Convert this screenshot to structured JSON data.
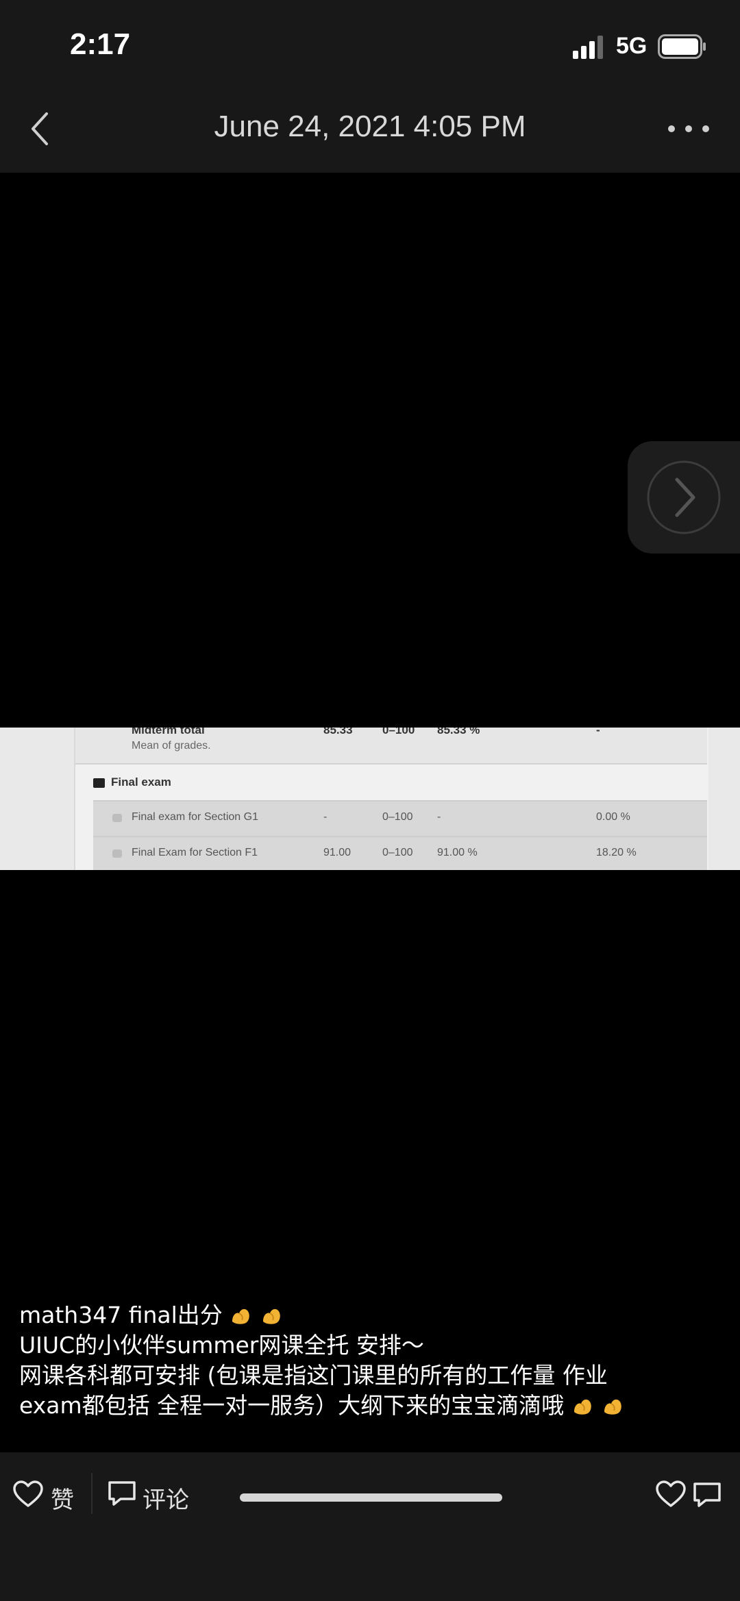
{
  "status_bar": {
    "time": "2:17",
    "network": "5G",
    "icons": [
      "signal-icon",
      "battery-icon"
    ]
  },
  "nav": {
    "title": "June 24, 2021 4:05 PM",
    "icons": [
      "back-icon",
      "more-icon"
    ]
  },
  "viewer": {
    "icons": [
      "chevron-right-icon"
    ]
  },
  "photo": {
    "midterm": {
      "name": "Midterm total",
      "description": "Mean of grades.",
      "grade": "85.33",
      "range": "0–100",
      "percentage": "85.33 %",
      "contribution": "-"
    },
    "section_title": "Final exam",
    "rows": [
      {
        "name": "Final exam for Section G1",
        "grade": "-",
        "range": "0–100",
        "percentage": "-",
        "contribution": "0.00 %"
      },
      {
        "name": "Final Exam for Section F1",
        "grade": "91.00",
        "range": "0–100",
        "percentage": "91.00 %",
        "contribution": "18.20 %"
      }
    ]
  },
  "caption": {
    "lines": [
      "math347 final出分",
      "UIUC的小伙伴summer网课全托 安排～",
      "网课各科都可安排 (包课是指这门课里的所有的工作量 作业",
      "exam都包括 全程一对一服务）大纲下来的宝宝滴滴哦"
    ],
    "emoji": "flexed-biceps-emoji"
  },
  "actions": {
    "like_label": "赞",
    "comment_label": "评论",
    "icons": [
      "heart-icon",
      "comment-icon"
    ]
  }
}
